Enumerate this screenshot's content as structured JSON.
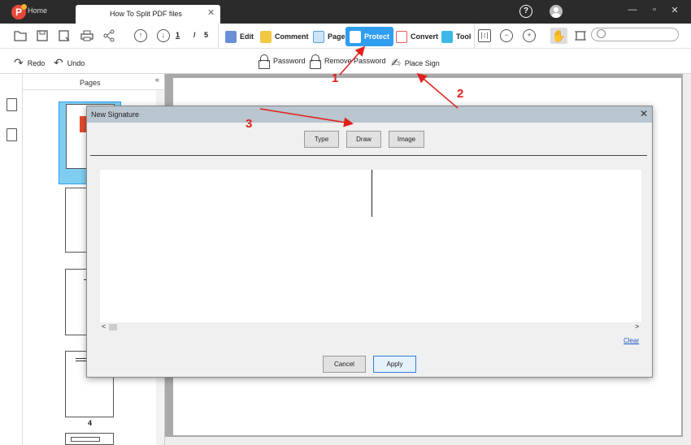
{
  "titlebar": {
    "logo_letter": "P",
    "home_label": "Home",
    "doc_tab_label": "How To Split PDF files",
    "doc_tab_close": "✕",
    "help_glyph": "?",
    "minimize": "—",
    "maximize": "▫",
    "close": "✕"
  },
  "toolbar": {
    "page_current": "1",
    "page_sep": "/",
    "page_total": "5",
    "tabs": [
      {
        "label": "Edit",
        "icon": "edit-icon",
        "color": "#6b8fd6"
      },
      {
        "label": "Comment",
        "icon": "comment-icon",
        "color": "#f2c744"
      },
      {
        "label": "Page",
        "icon": "page-icon",
        "color": "#5aa0e6"
      },
      {
        "label": "Protect",
        "icon": "protect-icon",
        "color": "#ffffff"
      },
      {
        "label": "Convert",
        "icon": "convert-icon",
        "color": "#e85a5a"
      },
      {
        "label": "Tool",
        "icon": "tool-icon",
        "color": "#3fb8e8"
      }
    ],
    "search_placeholder": ""
  },
  "subbar": {
    "redo": "Redo",
    "undo": "Undo",
    "password": "Password",
    "remove_password": "Remove Password",
    "place_sign": "Place Sign"
  },
  "pages_panel": {
    "title": "Pages",
    "collapse": "«",
    "thumb4_label": "4"
  },
  "dialog": {
    "title": "New Signature",
    "close": "✕",
    "tabs": [
      "Type",
      "Draw",
      "Image"
    ],
    "scroll_left": "<",
    "scroll_right": ">",
    "clear": "Clear",
    "cancel": "Cancel",
    "apply": "Apply"
  },
  "annotations": [
    "1",
    "2",
    "3"
  ],
  "colors": {
    "accent": "#2f9ef1",
    "annotation": "#e0201b",
    "titlebar": "#2b2b2b"
  }
}
